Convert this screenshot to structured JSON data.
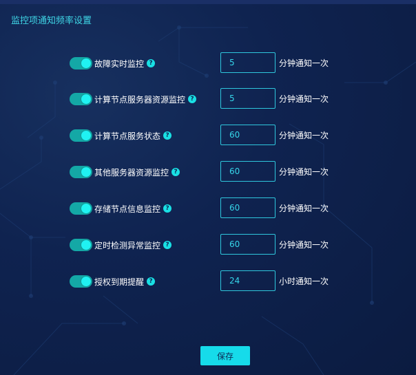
{
  "page": {
    "title": "监控项通知频率设置"
  },
  "items": [
    {
      "label": "故障实时监控",
      "value": "5",
      "unit": "分钟通知一次",
      "enabled": true
    },
    {
      "label": "计算节点服务器资源监控",
      "value": "5",
      "unit": "分钟通知一次",
      "enabled": true
    },
    {
      "label": "计算节点服务状态",
      "value": "60",
      "unit": "分钟通知一次",
      "enabled": true
    },
    {
      "label": "其他服务器资源监控",
      "value": "60",
      "unit": "分钟通知一次",
      "enabled": true
    },
    {
      "label": "存储节点信息监控",
      "value": "60",
      "unit": "分钟通知一次",
      "enabled": true
    },
    {
      "label": "定时检测异常监控",
      "value": "60",
      "unit": "分钟通知一次",
      "enabled": true
    },
    {
      "label": "授权到期提醒",
      "value": "24",
      "unit": "小时通知一次",
      "enabled": true
    }
  ],
  "help_icon": {
    "glyph": "?",
    "icon": "question-circle-icon"
  },
  "save_label": "保存",
  "colors": {
    "accent": "#19e0e4",
    "toggle_track": "#14a8a6",
    "background": "#0f2350",
    "title": "#3fd6e6"
  }
}
